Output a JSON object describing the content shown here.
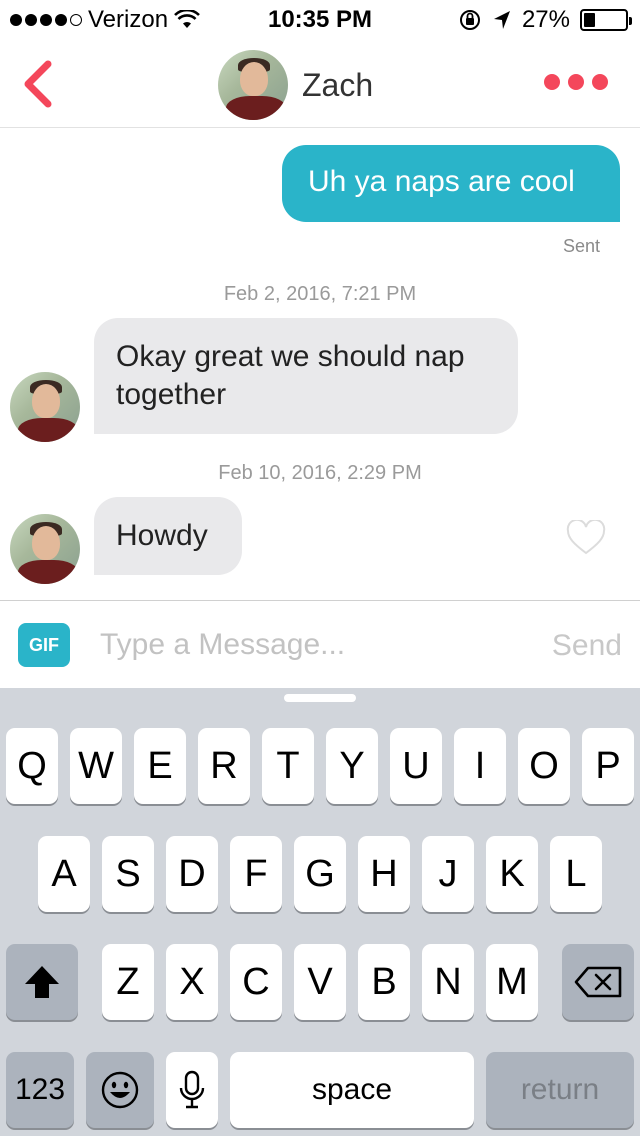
{
  "status_bar": {
    "carrier": "Verizon",
    "time": "10:35 PM",
    "battery": "27%",
    "battery_level": 0.27,
    "signal_bars": 4
  },
  "header": {
    "title": "Zach",
    "back_icon": "chevron-left-icon",
    "more_icon": "more-dots-icon",
    "accent_color": "#f4475b"
  },
  "messages": {
    "outgoing_1": {
      "text": "Uh ya naps are cool",
      "status": "Sent"
    },
    "timestamp_1": "Feb 2, 2016, 7:21 PM",
    "incoming_1": {
      "line1": "Okay great we should nap",
      "line2": "together"
    },
    "timestamp_2": "Feb 10, 2016, 2:29 PM",
    "incoming_2": {
      "text": "Howdy"
    },
    "bubble_color_out": "#2ab4c9",
    "bubble_color_in": "#e9e9eb"
  },
  "composer": {
    "gif_label": "GIF",
    "placeholder": "Type a Message...",
    "send_label": "Send"
  },
  "keyboard": {
    "row1": [
      "Q",
      "W",
      "E",
      "R",
      "T",
      "Y",
      "U",
      "I",
      "O",
      "P"
    ],
    "row2": [
      "A",
      "S",
      "D",
      "F",
      "G",
      "H",
      "J",
      "K",
      "L"
    ],
    "row3": [
      "Z",
      "X",
      "C",
      "V",
      "B",
      "N",
      "M"
    ],
    "numbers_label": "123",
    "space_label": "space",
    "return_label": "return"
  }
}
